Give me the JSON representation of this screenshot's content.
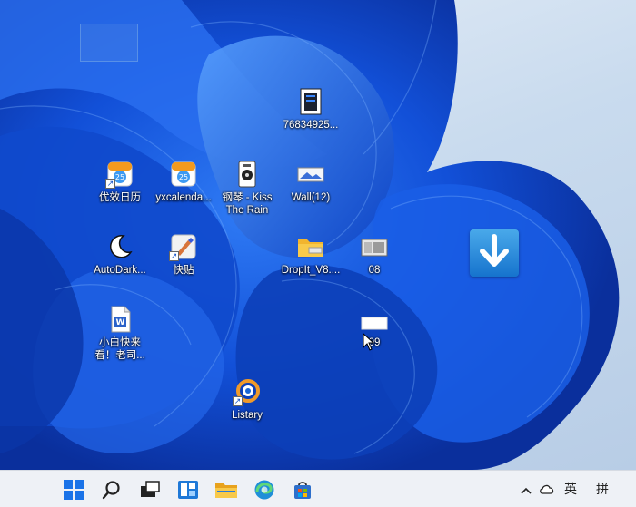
{
  "desktop": {
    "icons": [
      {
        "label": "76834925..."
      },
      {
        "label": "优效日历"
      },
      {
        "label": "yxcalenda..."
      },
      {
        "label": "钢琴 - Kiss\nThe Rain"
      },
      {
        "label": "Wall(12)"
      },
      {
        "label": "AutoDark..."
      },
      {
        "label": "快贴"
      },
      {
        "label": "DropIt_V8...."
      },
      {
        "label": "08"
      },
      {
        "label": "小白快来\n看！老司..."
      },
      {
        "label": "09"
      },
      {
        "label": "Listary"
      }
    ]
  },
  "taskbar": {
    "tray": {
      "ime_lang": "英",
      "ime_mode": "拼"
    }
  },
  "colors": {
    "taskbar_bg": "#eef1f6",
    "wallpaper_blue": "#1456d6",
    "accent": "#0a5bd6"
  }
}
